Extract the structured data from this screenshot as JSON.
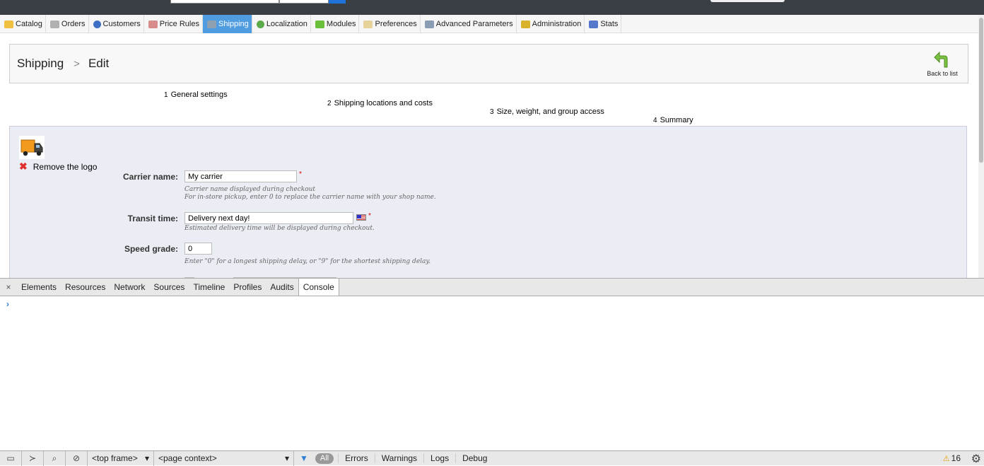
{
  "menu": [
    {
      "label": "Catalog",
      "icon": "folder-icon",
      "cls": "catalog"
    },
    {
      "label": "Orders",
      "icon": "cart-icon",
      "cls": "orders"
    },
    {
      "label": "Customers",
      "icon": "user-icon",
      "cls": "customers"
    },
    {
      "label": "Price Rules",
      "icon": "price-tag-icon",
      "cls": "price"
    },
    {
      "label": "Shipping",
      "icon": "truck-icon",
      "cls": "shipping",
      "active": true
    },
    {
      "label": "Localization",
      "icon": "globe-icon",
      "cls": "local"
    },
    {
      "label": "Modules",
      "icon": "puzzle-icon",
      "cls": "modules"
    },
    {
      "label": "Preferences",
      "icon": "preferences-icon",
      "cls": "pref"
    },
    {
      "label": "Advanced Parameters",
      "icon": "wrench-icon",
      "cls": "adv"
    },
    {
      "label": "Administration",
      "icon": "key-icon",
      "cls": "admin"
    },
    {
      "label": "Stats",
      "icon": "bar-chart-icon",
      "cls": "stats"
    }
  ],
  "breadcrumb": {
    "section": "Shipping",
    "separator": ">",
    "page": "Edit"
  },
  "back": {
    "label": "Back to list"
  },
  "steps": [
    {
      "num": "1",
      "label": "General settings"
    },
    {
      "num": "2",
      "label": "Shipping locations and costs"
    },
    {
      "num": "3",
      "label": "Size, weight, and group access"
    },
    {
      "num": "4",
      "label": "Summary"
    }
  ],
  "logo": {
    "remove_label": "Remove the logo"
  },
  "form": {
    "carrier_name": {
      "label": "Carrier name:",
      "value": "My carrier",
      "hint1": "Carrier name displayed during checkout",
      "hint2": "For in-store pickup, enter 0 to replace the carrier name with your shop name."
    },
    "transit_time": {
      "label": "Transit time:",
      "value": "Delivery next day!",
      "hint": "Estimated delivery time will be displayed during checkout."
    },
    "speed_grade": {
      "label": "Speed grade:",
      "value": "0",
      "hint": "Enter \"0\" for a longest shipping delay, or \"9\" for the shortest shipping delay."
    },
    "required_mark": "*"
  },
  "devtools": {
    "close": "×",
    "tabs": [
      "Elements",
      "Resources",
      "Network",
      "Sources",
      "Timeline",
      "Profiles",
      "Audits",
      "Console"
    ],
    "active_tab": "Console",
    "prompt": "›",
    "status": {
      "frame": "<top frame>",
      "context": "<page context>",
      "all": "All",
      "levels": [
        "Errors",
        "Warnings",
        "Logs",
        "Debug"
      ],
      "warnings_count": "16"
    }
  }
}
